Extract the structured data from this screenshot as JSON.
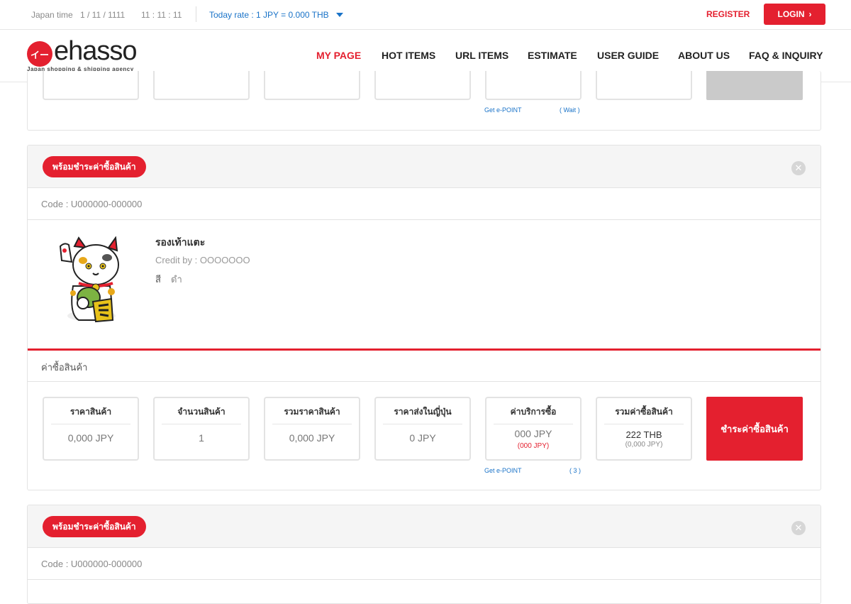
{
  "topbar": {
    "time_label": "Japan time",
    "date": "1 / 11 / 1111",
    "time": "11 : 11 : 11",
    "rate": "Today rate : 1 JPY = 0.000 THB",
    "register": "REGISTER",
    "login": "LOGIN"
  },
  "brand": {
    "mark": "イー",
    "name": "ehasso",
    "tagline": "Japan shopping & shipping agency",
    "accent_color": "#e4202f",
    "link_color": "#1a73c8"
  },
  "nav": [
    "MY PAGE",
    "HOT ITEMS",
    "URL ITEMS",
    "ESTIMATE",
    "USER GUIDE",
    "ABOUT US",
    "FAQ & INQUIRY"
  ],
  "top_card": {
    "epoint_label": "Get e-POINT",
    "epoint_value": "( Wait )"
  },
  "order": {
    "badge": "พร้อมชำระค่าซื้อสินค้า",
    "close_icon": "close-icon",
    "code": "Code : U000000-000000",
    "product": {
      "name": "รองเท้าแตะ",
      "credit": "Credit by : OOOOOOO",
      "color_label": "สี",
      "color_value": "ดำ"
    },
    "section_title": "ค่าซื้อสินค้า",
    "boxes": [
      {
        "title": "ราคาสินค้า",
        "value": "0,000 JPY"
      },
      {
        "title": "จำนวนสินค้า",
        "value": "1"
      },
      {
        "title": "รวมราคาสินค้า",
        "value": "0,000 JPY"
      },
      {
        "title": "ราคาส่งในญี่ปุ่น",
        "value": "0 JPY"
      },
      {
        "title": "ค่าบริการซื้อ",
        "value": "000 JPY",
        "sub": "(000 JPY)"
      },
      {
        "title": "รวมค่าซื้อสินค้า",
        "value": "222 THB",
        "sub": "(0,000 JPY)"
      }
    ],
    "epoint_label": "Get e-POINT",
    "epoint_value": "( 3 )",
    "pay_button": "ชำระค่าซื้อสินค้า"
  },
  "order2": {
    "badge": "พร้อมชำระค่าซื้อสินค้า",
    "code": "Code : U000000-000000"
  }
}
